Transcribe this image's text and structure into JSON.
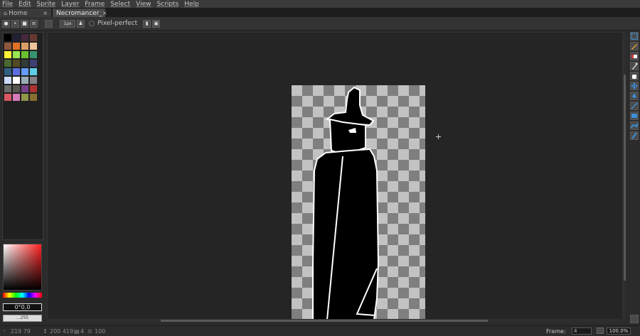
{
  "menu": [
    "File",
    "Edit",
    "Sprite",
    "Layer",
    "Frame",
    "Select",
    "View",
    "Scripts",
    "Help"
  ],
  "tabs": [
    {
      "label": "Home",
      "close": "×"
    },
    {
      "label": "Necromancer_",
      "close": "×"
    }
  ],
  "context_bar": {
    "pixel_perfect_label": "Pixel-perfect",
    "brush_size": "1px"
  },
  "palette": {
    "colors": [
      "#000000",
      "#222034",
      "#45283c",
      "#663931",
      "#8f563b",
      "#df7126",
      "#d9a066",
      "#eec39a",
      "#fbf236",
      "#99e550",
      "#6abe30",
      "#37946e",
      "#4b692f",
      "#524b24",
      "#323c39",
      "#3f3f74",
      "#306082",
      "#5b6ee1",
      "#639bff",
      "#5fcde4",
      "#cbdbfc",
      "#ffffff",
      "#9badb7",
      "#847e87",
      "#696a6a",
      "#595652",
      "#76428a",
      "#ac3232",
      "#d95763",
      "#d77bba",
      "#8f974a",
      "#8a6f30"
    ]
  },
  "color_picker": {
    "value": "0°0,0",
    "alpha_label": "...255"
  },
  "status": {
    "cursor_pos": "219 79",
    "sprite_size": "200 419",
    "frames": "4",
    "zoom_pct": "100",
    "frame_label": "Frame:",
    "frame_value": "4",
    "zoom_value": "100.0%"
  },
  "tools": [
    "selection-tool",
    "pencil-tool",
    "eraser-tool",
    "eyedropper-tool",
    "hand-tool",
    "move-tool",
    "fill-tool",
    "line-tool",
    "rectangle-tool",
    "contour-tool",
    "blur-tool"
  ],
  "colors": {
    "accent": "#3a8ed8",
    "background": "#2b2b2b",
    "canvas_bg": "#252525"
  }
}
